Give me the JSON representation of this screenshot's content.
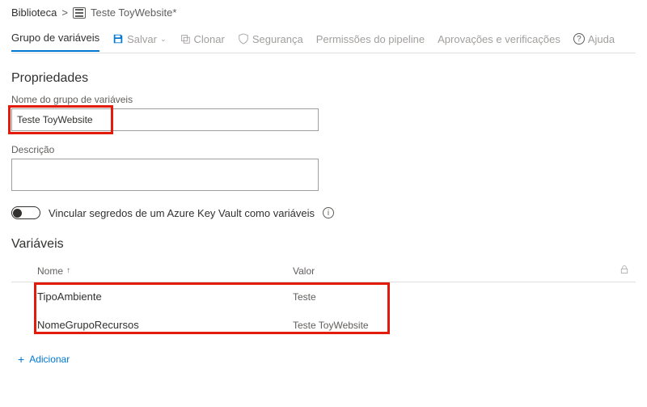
{
  "breadcrumb": {
    "root": "Biblioteca",
    "sep": ">",
    "current": "Teste ToyWebsite*"
  },
  "tabs": {
    "variable_group": "Grupo de variáveis"
  },
  "toolbar": {
    "save": "Salvar",
    "clone": "Clonar",
    "security": "Segurança",
    "pipeline_permissions": "Permissões do pipeline",
    "approvals": "Aprovações e verificações",
    "help": "Ajuda"
  },
  "properties": {
    "section_title": "Propriedades",
    "name_label": "Nome do grupo de variáveis",
    "name_value": "Teste ToyWebsite",
    "desc_label": "Descrição",
    "desc_value": "",
    "kv_toggle_label": "Vincular segredos de um Azure Key Vault como variáveis"
  },
  "variables": {
    "section_title": "Variáveis",
    "col_name": "Nome",
    "col_value": "Valor",
    "rows": [
      {
        "name": "TipoAmbiente",
        "value": "Teste"
      },
      {
        "name": "NomeGrupoRecursos",
        "value": "Teste ToyWebsite"
      }
    ],
    "add_label": "Adicionar"
  }
}
